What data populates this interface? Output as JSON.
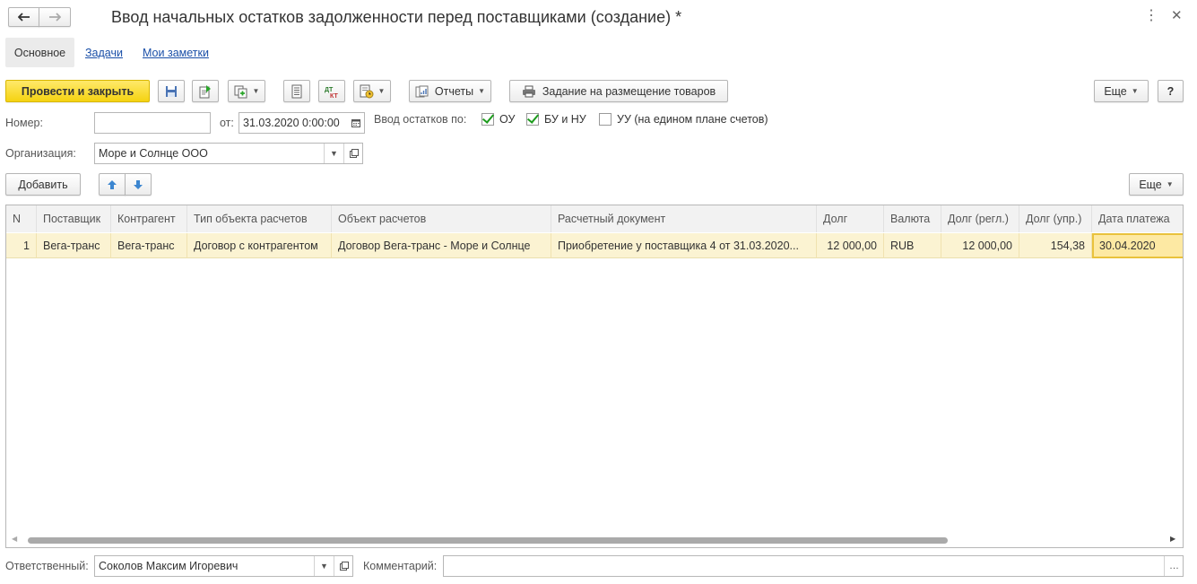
{
  "window": {
    "title": "Ввод начальных остатков задолженности перед поставщиками (создание) *"
  },
  "tabs": [
    {
      "label": "Основное",
      "active": true
    },
    {
      "label": "Задачи",
      "active": false
    },
    {
      "label": "Мои заметки",
      "active": false
    }
  ],
  "toolbar": {
    "post_close_label": "Провести и закрыть",
    "reports_label": "Отчеты",
    "task_label": "Задание на размещение товаров",
    "more_label": "Еще",
    "help_label": "?"
  },
  "form": {
    "number_label": "Номер:",
    "number_value": "",
    "date_label": "от:",
    "date_value": "31.03.2020  0:00:00",
    "balance_label": "Ввод остатков по:",
    "chk_ou_label": "ОУ",
    "chk_bu_label": "БУ и НУ",
    "chk_uu_label": "УУ (на едином плане счетов)",
    "chk_ou": true,
    "chk_bu": true,
    "chk_uu": false,
    "org_label": "Организация:",
    "org_value": "Море и Солнце ООО"
  },
  "table_toolbar": {
    "add_label": "Добавить",
    "more_label": "Еще"
  },
  "table": {
    "columns": [
      "N",
      "Поставщик",
      "Контрагент",
      "Тип объекта расчетов",
      "Объект расчетов",
      "Расчетный документ",
      "Долг",
      "Валюта",
      "Долг (регл.)",
      "Долг (упр.)",
      "Дата платежа"
    ],
    "rows": [
      [
        "1",
        "Вега-транс",
        "Вега-транс",
        "Договор с контрагентом",
        "Договор Вега-транс -  Море и Солнце",
        "Приобретение у поставщика 4 от 31.03.2020...",
        "12 000,00",
        "RUB",
        "12 000,00",
        "154,38",
        "30.04.2020"
      ]
    ]
  },
  "footer": {
    "responsible_label": "Ответственный:",
    "responsible_value": "Соколов Максим Игоревич",
    "comment_label": "Комментарий:",
    "comment_value": ""
  },
  "colors": {
    "primary_button": "#f5d311",
    "selected_row": "#fbf3d2",
    "link": "#1a4fa8",
    "check": "#1c9b1c",
    "arrow_blue": "#3c86d0"
  }
}
